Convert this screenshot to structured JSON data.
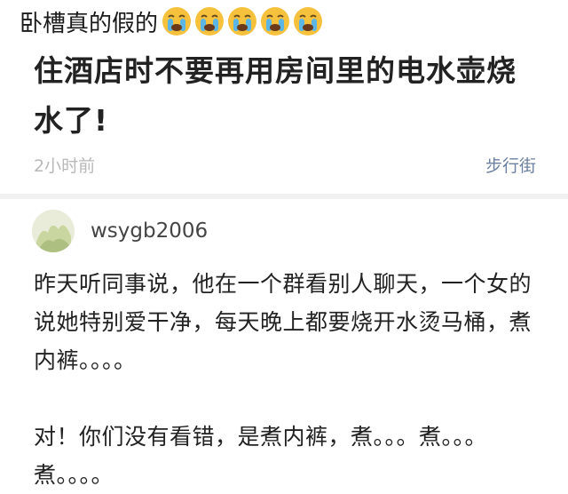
{
  "caption": {
    "text": "卧槽真的假的",
    "emoji": [
      "crying-face-icon",
      "crying-face-icon",
      "crying-face-icon",
      "crying-face-icon",
      "crying-face-icon"
    ]
  },
  "post": {
    "title": "住酒店时不要再用房间里的电水壶烧水了!",
    "time": "2小时前",
    "source": "步行街"
  },
  "comment": {
    "username": "wsygb2006",
    "paragraph1": "昨天听同事说，他在一个群看别人聊天，一个女的说她特别爱干净，每天晚上都要烧开水烫马桶，煮内裤。。。。",
    "paragraph2": "对！你们没有看错，是煮内裤，煮。。。煮。。。煮。。。。"
  },
  "colors": {
    "emoji_face": "#f6c23e",
    "emoji_tears": "#5bb6e6",
    "meta_time": "#b8b8b8",
    "meta_source": "#6b7fa0",
    "divider": "#f1f1f1"
  }
}
